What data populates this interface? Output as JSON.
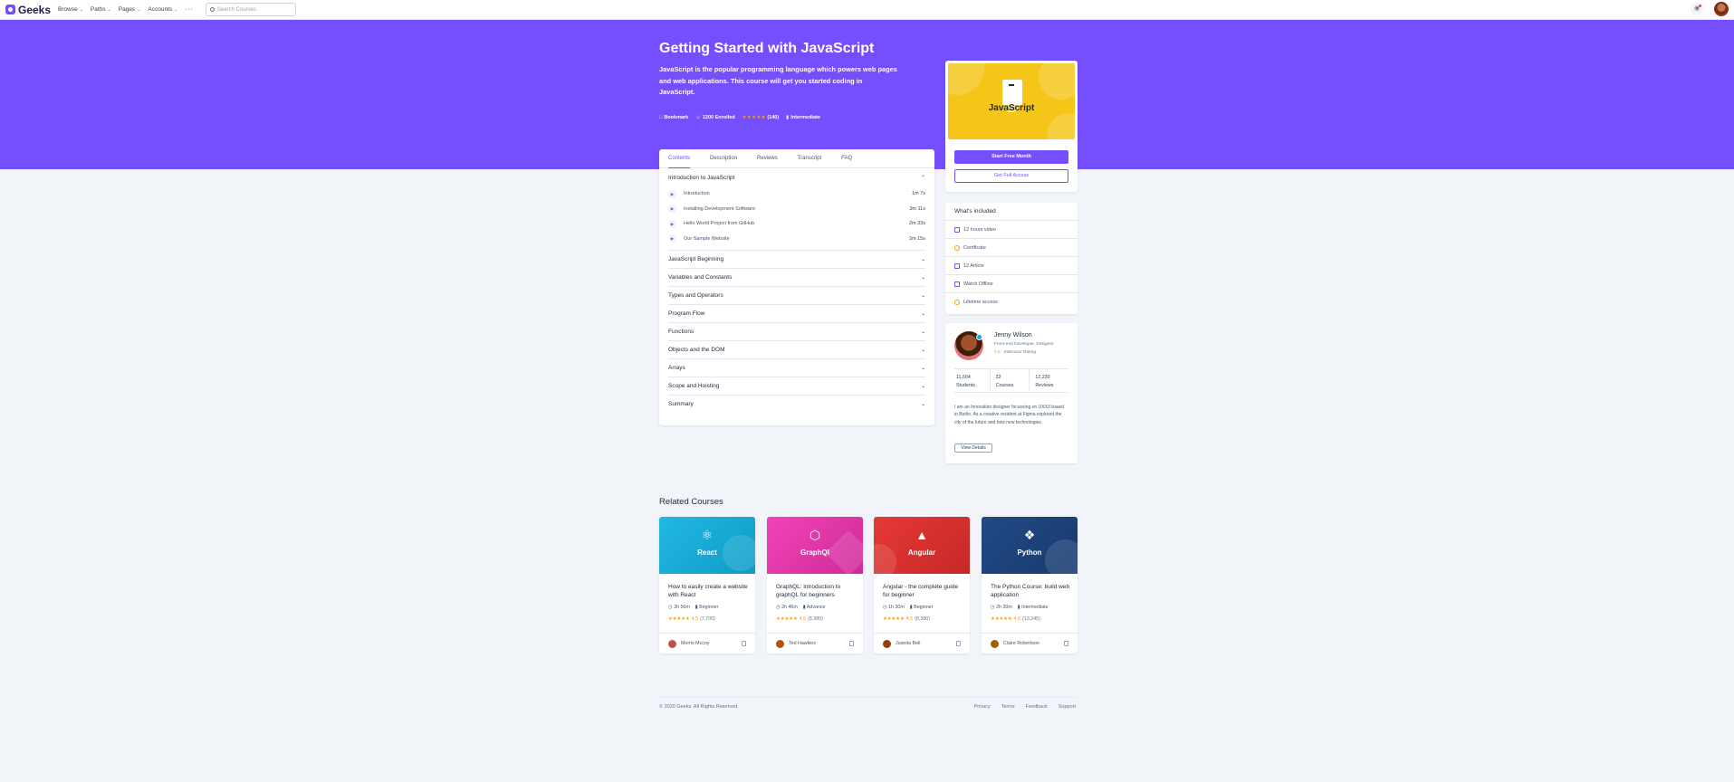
{
  "nav": {
    "brand": "Geeks",
    "links": [
      {
        "label": "Browse"
      },
      {
        "label": "Paths"
      },
      {
        "label": "Pages"
      },
      {
        "label": "Accounts"
      }
    ],
    "more": "···",
    "search_placeholder": "Search Courses"
  },
  "hero": {
    "title": "Getting Started with JavaScript",
    "description": "JavaScript is the popular programming language which powers web pages and web applications. This course will get you started coding in JavaScript.",
    "bookmark": "Bookmark",
    "enrolled": "1200 Enrolled",
    "stars": "★★★★★",
    "reviews": "(140)",
    "level": "Intermediate"
  },
  "tabs": [
    "Contents",
    "Description",
    "Reviews",
    "Transcript",
    "FAQ"
  ],
  "contents": {
    "open_section": "Introduction to JavaScript",
    "lessons": [
      {
        "title": "Introduction",
        "duration": "1m 7s"
      },
      {
        "title": "Installing Development Software",
        "duration": "3m 11s"
      },
      {
        "title": "Hello World Project from GitHub",
        "duration": "2m 33s"
      },
      {
        "title": "Our Sample Website",
        "duration": "2m 15s"
      }
    ],
    "sections": [
      "JavaScript Beginning",
      "Variables and Constants",
      "Types and Operators",
      "Program Flow",
      "Functions",
      "Objects and the DOM",
      "Arrays",
      "Scope and Hoisting",
      "Summary"
    ]
  },
  "promo": {
    "image_label": "JavaScript",
    "start_button": "Start Free Month",
    "full_access_button": "Get Full Access"
  },
  "included": {
    "title": "What's included",
    "items": [
      "12 hours video",
      "Certificate",
      "12 Article",
      "Watch Offline",
      "Lifetime access"
    ]
  },
  "instructor": {
    "name": "Jenny Wilson",
    "role": "Front-end Developer, Designer",
    "rating": "4.5",
    "rating_label": "Instructor Rating",
    "stats": [
      {
        "value": "11,604",
        "label": "Students"
      },
      {
        "value": "32",
        "label": "Courses"
      },
      {
        "value": "12,230",
        "label": "Reviews"
      }
    ],
    "bio": "I am an Innovation designer focussing on UX/UI based in Berlin. As a creative resident at Figma explored the city of the future and how new technologies.",
    "button": "View Details"
  },
  "related": {
    "title": "Related Courses",
    "courses": [
      {
        "thumb": "React",
        "title": "How to easily create a website with React",
        "time": "3h 56m",
        "level": "Beginner",
        "stars": "★★★★★",
        "rating": "4.5",
        "count": "(7,700)",
        "author": "Morris Mccoy",
        "color": "#22b8e3"
      },
      {
        "thumb": "GraphQl",
        "title": "GraphQL: introduction to graphQL for beginners",
        "time": "2h 46m",
        "level": "Advance",
        "stars": "★★★★★",
        "rating": "4.5",
        "count": "(6,380)",
        "author": "Ted Hawkins",
        "color": "#e535ab"
      },
      {
        "thumb": "Angular",
        "title": "Angular - the complete guide for beginner",
        "time": "1h 30m",
        "level": "Beginner",
        "stars": "★★★★★",
        "rating": "4.5",
        "count": "(8,380)",
        "author": "Juanita Bell",
        "color": "#dd2c2c"
      },
      {
        "thumb": "Python",
        "title": "The Python Course: build web application",
        "time": "2h 30m",
        "level": "Intermediate",
        "stars": "★★★★★",
        "rating": "4.5",
        "count": "(13,245)",
        "author": "Claire Robertson",
        "color": "#1e4e8c"
      }
    ]
  },
  "footer": {
    "copyright": "© 2020 Geeks. All Rights Reserved.",
    "links": [
      "Privacy",
      "Terms",
      "Feedback",
      "Support"
    ]
  },
  "colors": {
    "accent": "#754ffe",
    "star": "#f59e0b",
    "promo_bg": "#f5c518"
  }
}
